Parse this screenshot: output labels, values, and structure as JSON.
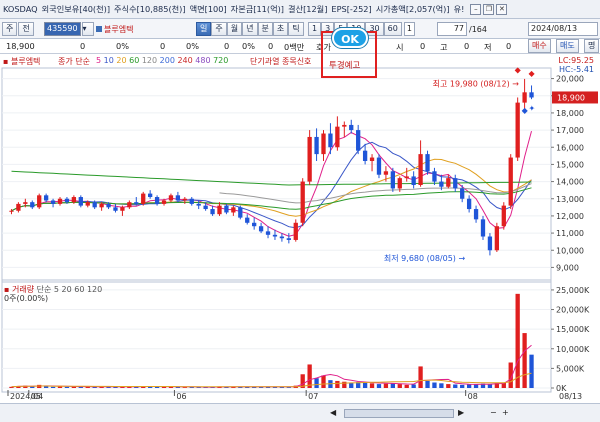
{
  "info": {
    "market": "KOSDAQ",
    "foreign": "외국인보유[40(천)]",
    "shares": "주식수[10,885(천)]",
    "par": "액면[100]",
    "capital": "자본금[11(억)]",
    "settle": "결산[12월]",
    "eps": "EPS[-252]",
    "mcap": "시가총액[2,057(억)]",
    "yu": "유!"
  },
  "toolbar": {
    "mode1": "주",
    "mode2": "전",
    "code": "435590",
    "name": "블루엠텍",
    "tabs": [
      "일",
      "주",
      "월",
      "년",
      "분",
      "초",
      "틱"
    ],
    "period_opts": [
      "1",
      "3",
      "5",
      "10",
      "30",
      "60"
    ],
    "period_one": "1",
    "count": "77",
    "total": "/164",
    "date": "2024/08/13"
  },
  "pricebar": {
    "price": "18,900",
    "zero1": "0",
    "pct1": "0%",
    "zero2": "0",
    "pct2": "0%",
    "zero3": "0",
    "pct3": "0%",
    "zero4": "0",
    "pct4": "0%",
    "bp": "0백만",
    "label_pan": "판",
    "label_ho": "호가",
    "zero5": "0",
    "label_si": "시",
    "zero6": "0",
    "label_go": "고",
    "zero7": "0",
    "label_je": "저",
    "zero8": "0",
    "buy": "매수",
    "sell": "매도",
    "more": "명"
  },
  "legend": {
    "name": "블루엠텍",
    "ma_label": "종가 단순",
    "ma_vals": [
      "5",
      "10",
      "20",
      "60",
      "120",
      "200",
      "240",
      "480",
      "720"
    ],
    "ma_colors": [
      "#e0208a",
      "#3a57c8",
      "#e0a020",
      "#2a9a2a",
      "#888888",
      "#3c6ad8",
      "#cc2b2b",
      "#8a4bc0",
      "#2a9a2a"
    ],
    "overheat": "단기과열 종목신호",
    "badge_ok": "OK",
    "badge_text": "투경예고"
  },
  "chart_data": {
    "type": "candlestick",
    "x_ticks": [
      "2024/04",
      "05",
      "06",
      "07",
      "08",
      "08/13"
    ],
    "price_axis": [
      "20,000",
      "19,000",
      "18,000",
      "17,000",
      "16,000",
      "15,000",
      "14,000",
      "13,000",
      "12,000",
      "11,000",
      "10,000",
      "9,000"
    ],
    "high_label": "최고 19,980 (08/12)",
    "low_label": "최저 9,680 (08/05)",
    "current_price": "18,900",
    "lc": "LC:95.25",
    "hc": "HC:-5.41",
    "volume_axis": [
      "25,000K",
      "20,000K",
      "15,000K",
      "10,000K",
      "5,000K",
      "0K"
    ],
    "volume_label": "거래량",
    "volume_ma": "단순 5 20 60 120",
    "volume_value": "0주(0.00%)",
    "candles": [
      [
        12.3,
        12.4,
        12.1,
        12.3
      ],
      [
        12.3,
        12.8,
        12.2,
        12.7
      ],
      [
        12.7,
        13.0,
        12.5,
        12.8
      ],
      [
        12.8,
        12.9,
        12.4,
        12.5
      ],
      [
        12.5,
        13.3,
        12.4,
        13.2
      ],
      [
        13.2,
        13.3,
        12.8,
        12.9
      ],
      [
        12.9,
        13.0,
        12.5,
        12.7
      ],
      [
        12.7,
        13.1,
        12.6,
        13.0
      ],
      [
        13.0,
        13.1,
        12.7,
        12.8
      ],
      [
        12.8,
        13.2,
        12.7,
        13.1
      ],
      [
        13.1,
        13.2,
        12.5,
        12.6
      ],
      [
        12.6,
        12.9,
        12.5,
        12.8
      ],
      [
        12.8,
        12.9,
        12.4,
        12.5
      ],
      [
        12.5,
        12.8,
        12.3,
        12.7
      ],
      [
        12.7,
        12.8,
        12.4,
        12.5
      ],
      [
        12.5,
        12.7,
        12.2,
        12.3
      ],
      [
        12.3,
        12.6,
        12.0,
        12.5
      ],
      [
        12.5,
        12.9,
        12.4,
        12.8
      ],
      [
        12.8,
        13.1,
        12.6,
        12.7
      ],
      [
        12.7,
        13.4,
        12.6,
        13.3
      ],
      [
        13.3,
        13.5,
        13.0,
        13.1
      ],
      [
        13.1,
        13.2,
        12.6,
        12.7
      ],
      [
        12.7,
        13.0,
        12.6,
        12.9
      ],
      [
        12.9,
        13.3,
        12.8,
        13.2
      ],
      [
        13.2,
        13.4,
        12.8,
        12.9
      ],
      [
        12.9,
        13.1,
        12.7,
        13.0
      ],
      [
        13.0,
        13.1,
        12.6,
        12.7
      ],
      [
        12.7,
        12.9,
        12.4,
        12.6
      ],
      [
        12.6,
        12.8,
        12.3,
        12.4
      ],
      [
        12.4,
        12.6,
        12.0,
        12.1
      ],
      [
        12.1,
        12.8,
        12.0,
        12.6
      ],
      [
        12.6,
        12.7,
        12.1,
        12.2
      ],
      [
        12.2,
        12.6,
        12.0,
        12.5
      ],
      [
        12.5,
        12.6,
        11.8,
        11.9
      ],
      [
        11.9,
        12.1,
        11.5,
        11.6
      ],
      [
        11.6,
        11.9,
        11.2,
        11.4
      ],
      [
        11.4,
        11.6,
        11.0,
        11.1
      ],
      [
        11.1,
        11.4,
        10.7,
        10.9
      ],
      [
        10.9,
        11.2,
        10.6,
        10.8
      ],
      [
        10.8,
        11.0,
        10.5,
        10.7
      ],
      [
        10.7,
        11.0,
        10.4,
        10.6
      ],
      [
        10.6,
        11.8,
        10.5,
        11.6
      ],
      [
        11.6,
        14.2,
        11.4,
        14.0
      ],
      [
        14.0,
        17.0,
        13.8,
        16.6
      ],
      [
        16.6,
        17.1,
        15.2,
        15.6
      ],
      [
        15.6,
        17.0,
        15.2,
        16.8
      ],
      [
        16.8,
        17.4,
        15.6,
        16.0
      ],
      [
        16.0,
        17.8,
        15.8,
        17.2
      ],
      [
        17.2,
        17.5,
        16.6,
        17.3
      ],
      [
        17.3,
        17.6,
        16.8,
        17.0
      ],
      [
        17.0,
        17.3,
        15.6,
        15.8
      ],
      [
        15.8,
        16.2,
        15.0,
        15.2
      ],
      [
        15.2,
        15.6,
        14.6,
        15.4
      ],
      [
        15.4,
        15.6,
        14.2,
        14.4
      ],
      [
        14.4,
        14.9,
        14.0,
        14.6
      ],
      [
        14.6,
        14.8,
        13.4,
        13.6
      ],
      [
        13.6,
        14.3,
        13.4,
        14.2
      ],
      [
        14.2,
        14.8,
        14.0,
        14.3
      ],
      [
        14.3,
        14.6,
        13.6,
        13.8
      ],
      [
        13.8,
        16.4,
        13.7,
        15.6
      ],
      [
        15.6,
        15.8,
        14.4,
        14.6
      ],
      [
        14.6,
        14.8,
        13.8,
        14.0
      ],
      [
        14.0,
        14.4,
        13.5,
        13.7
      ],
      [
        13.7,
        14.4,
        13.6,
        14.2
      ],
      [
        14.2,
        14.4,
        13.4,
        13.6
      ],
      [
        13.6,
        13.8,
        12.8,
        13.0
      ],
      [
        13.0,
        13.2,
        12.2,
        12.4
      ],
      [
        12.4,
        12.6,
        11.6,
        11.8
      ],
      [
        11.8,
        12.0,
        10.6,
        10.8
      ],
      [
        10.8,
        11.0,
        9.7,
        10.0
      ],
      [
        10.0,
        11.6,
        9.9,
        11.4
      ],
      [
        11.4,
        12.8,
        11.2,
        12.6
      ],
      [
        12.6,
        15.6,
        12.4,
        15.4
      ],
      [
        15.4,
        18.9,
        15.2,
        18.6
      ],
      [
        18.6,
        19.98,
        18.0,
        19.2
      ],
      [
        19.2,
        19.6,
        18.8,
        18.9
      ]
    ],
    "volumes": [
      0.3,
      0.5,
      0.6,
      0.4,
      0.8,
      0.4,
      0.3,
      0.5,
      0.3,
      0.4,
      0.3,
      0.3,
      0.3,
      0.3,
      0.3,
      0.3,
      0.3,
      0.4,
      0.3,
      0.5,
      0.4,
      0.3,
      0.3,
      0.4,
      0.3,
      0.2,
      0.3,
      0.2,
      0.2,
      0.3,
      0.4,
      0.3,
      0.3,
      0.3,
      0.3,
      0.3,
      0.3,
      0.4,
      0.3,
      0.3,
      0.2,
      0.6,
      3.5,
      6.0,
      2.5,
      3.2,
      2.0,
      1.8,
      1.6,
      1.4,
      1.5,
      1.3,
      1.2,
      1.0,
      1.1,
      1.2,
      1.0,
      0.8,
      0.9,
      5.5,
      1.8,
      1.4,
      1.2,
      1.0,
      0.9,
      0.8,
      0.9,
      1.0,
      1.1,
      1.0,
      1.3,
      1.4,
      6.5,
      24.0,
      14.0,
      8.5
    ]
  },
  "bottom": {
    "label1": "2024/04",
    "label2": "05",
    "label3": "06",
    "label4": "07",
    "label5": "08",
    "label6": "08/13"
  }
}
